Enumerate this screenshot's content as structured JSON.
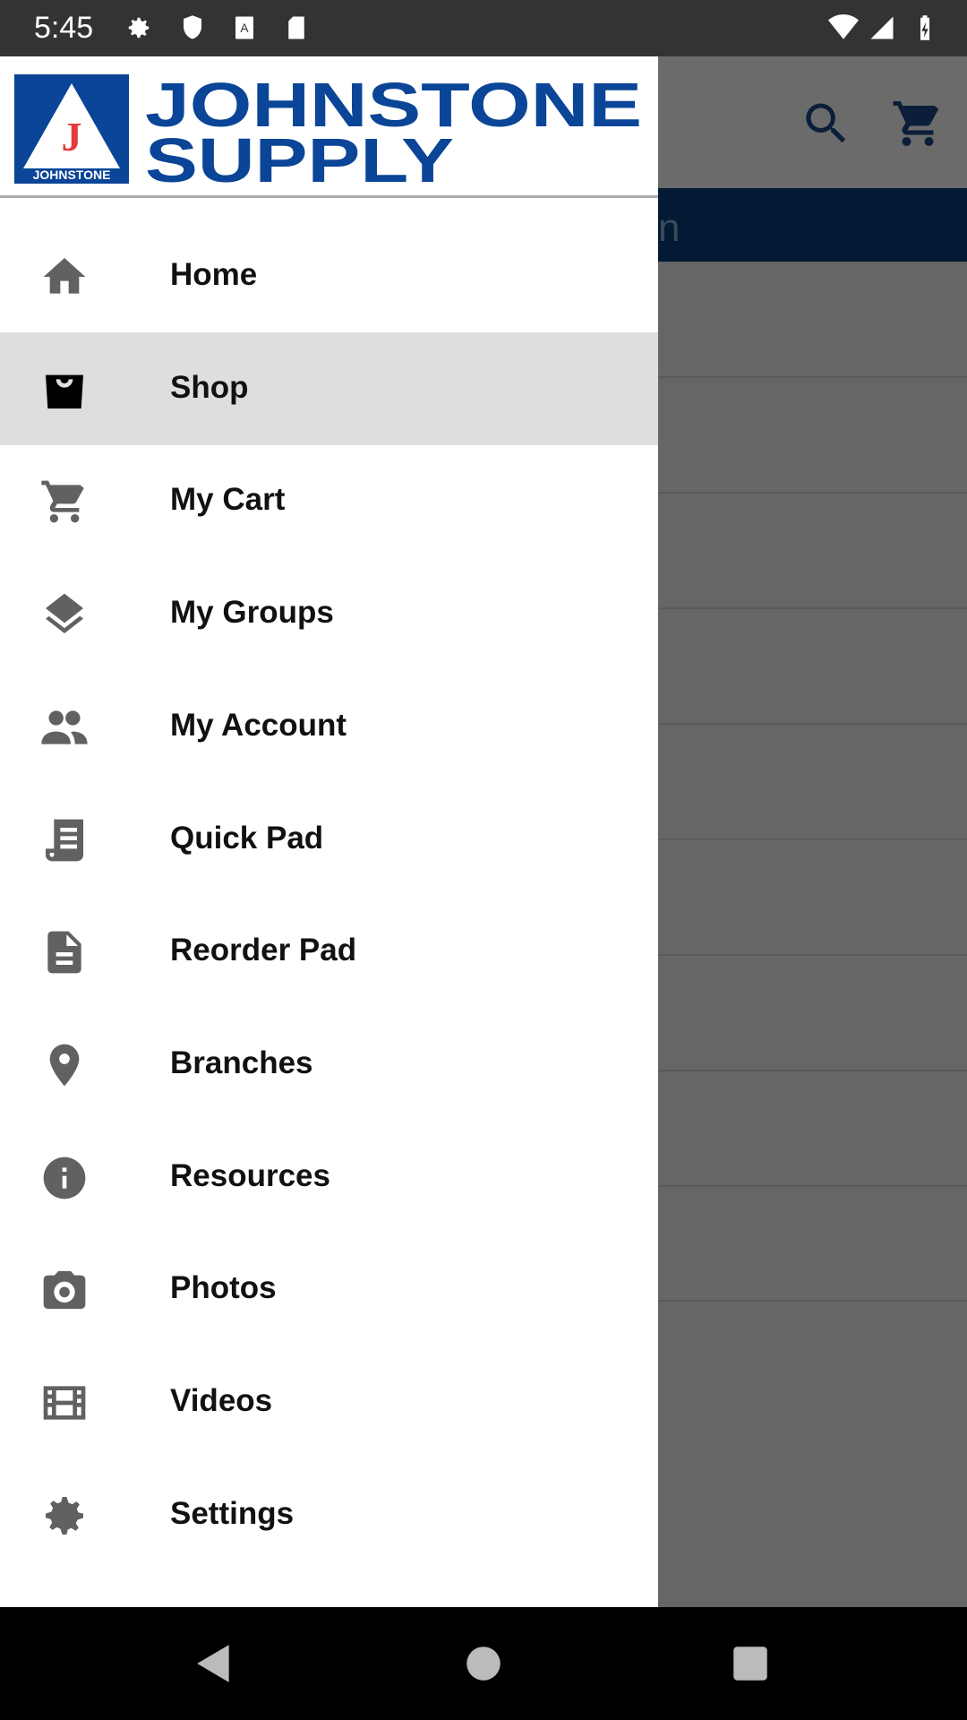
{
  "status_bar": {
    "time": "5:45",
    "icons": [
      "gear-icon",
      "shield-icon",
      "a-icon",
      "sd-card-icon",
      "wifi-icon",
      "signal-icon",
      "battery-charging-icon"
    ]
  },
  "background_app": {
    "icons": [
      "search-icon",
      "cart-icon"
    ],
    "navy_partial_text": "n",
    "colors": {
      "navy": "#021a33"
    }
  },
  "drawer": {
    "logo": {
      "line1": "JOHNSTONE",
      "line2": "SUPPLY",
      "badge": "JOHNSTONE",
      "mark": "J",
      "colors": {
        "blue": "#0a4597",
        "red": "#e63a3a"
      }
    },
    "items": [
      {
        "label": "Home",
        "icon": "home-icon"
      },
      {
        "label": "Shop",
        "icon": "shopping-bag-icon",
        "active": true
      },
      {
        "label": "My Cart",
        "icon": "cart-icon"
      },
      {
        "label": "My Groups",
        "icon": "layers-icon"
      },
      {
        "label": "My Account",
        "icon": "people-icon"
      },
      {
        "label": "Quick Pad",
        "icon": "receipt-icon"
      },
      {
        "label": "Reorder Pad",
        "icon": "document-icon"
      },
      {
        "label": "Branches",
        "icon": "location-pin-icon"
      },
      {
        "label": "Resources",
        "icon": "info-icon"
      },
      {
        "label": "Photos",
        "icon": "camera-icon"
      },
      {
        "label": "Videos",
        "icon": "film-icon"
      },
      {
        "label": "Settings",
        "icon": "gear-icon"
      }
    ]
  },
  "nav_bar": {
    "icons": [
      "back-icon",
      "home-circle-icon",
      "recents-icon"
    ]
  }
}
